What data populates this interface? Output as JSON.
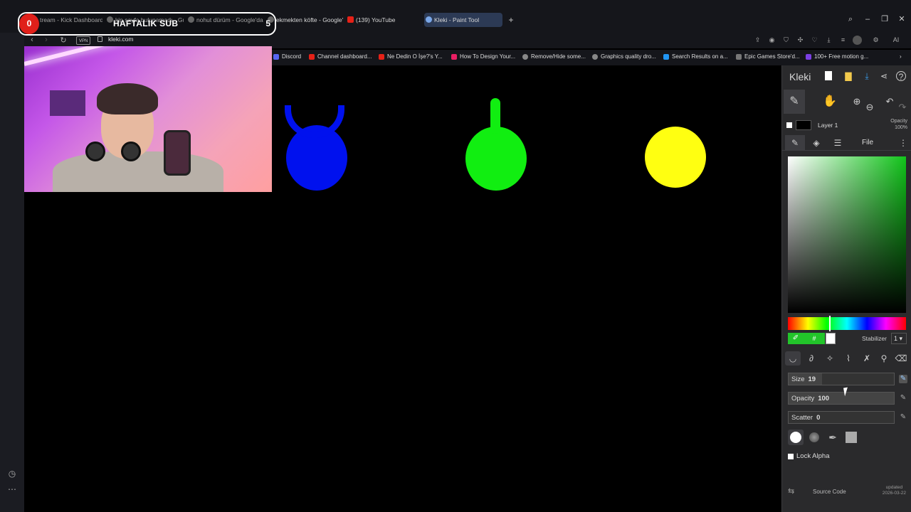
{
  "browser": {
    "tabs": [
      {
        "label": "tream - Kick Dashboard",
        "active": false
      },
      {
        "label": "kip sayfa bulunamadı - Gu",
        "active": false
      },
      {
        "label": "nohut dürüm - Google'da",
        "active": false
      },
      {
        "label": "ekmekten köfte - Google'",
        "active": false
      },
      {
        "label": "(139) YouTube",
        "active": false
      },
      {
        "label": "Kleki - Paint Tool",
        "active": true
      }
    ],
    "vpn_label": "VPN",
    "url": "kleki.com",
    "ai_label": "AI",
    "bookmarks": [
      {
        "label": "Discord",
        "color": "#5865f2"
      },
      {
        "label": "Channel dashboard...",
        "color": "#e62117"
      },
      {
        "label": "Ne Dedin O İşe?'s Y...",
        "color": "#e62117"
      },
      {
        "label": "How To Design Your...",
        "color": "#e91e63"
      },
      {
        "label": "Remove/Hide some...",
        "color": "#888888"
      },
      {
        "label": "Graphics quality dro...",
        "color": "#888888"
      },
      {
        "label": "Search Results on a...",
        "color": "#2196f3"
      },
      {
        "label": "Epic Games Store'd...",
        "color": "#777777"
      },
      {
        "label": "100+ Free motion g...",
        "color": "#7b3fe4"
      }
    ]
  },
  "overlay": {
    "badge_count": "0",
    "title": "HAFTALIK SUB",
    "goal": "5"
  },
  "canvas": {
    "shapes": [
      {
        "name": "blue-shape",
        "color": "#0011ee"
      },
      {
        "name": "green-shape",
        "color": "#11ee11"
      },
      {
        "name": "yellow-shape",
        "color": "#ffff11"
      }
    ]
  },
  "kleki": {
    "app_name": "Kleki",
    "layer_name": "Layer 1",
    "layer_opacity_label": "Opacity",
    "layer_opacity_value": "100%",
    "file_tab": "File",
    "hex_symbol": "#",
    "stabilizer_label": "Stabilizer",
    "stabilizer_value": "1",
    "size_label": "Size",
    "size_value": "19",
    "opacity_label": "Opacity",
    "opacity_value": "100",
    "scatter_label": "Scatter",
    "scatter_value": "0",
    "lock_alpha_label": "Lock Alpha",
    "source_code_label": "Source Code",
    "updated_label": "updated",
    "updated_date": "2026-03-22",
    "primary_color": "#22c42a"
  }
}
